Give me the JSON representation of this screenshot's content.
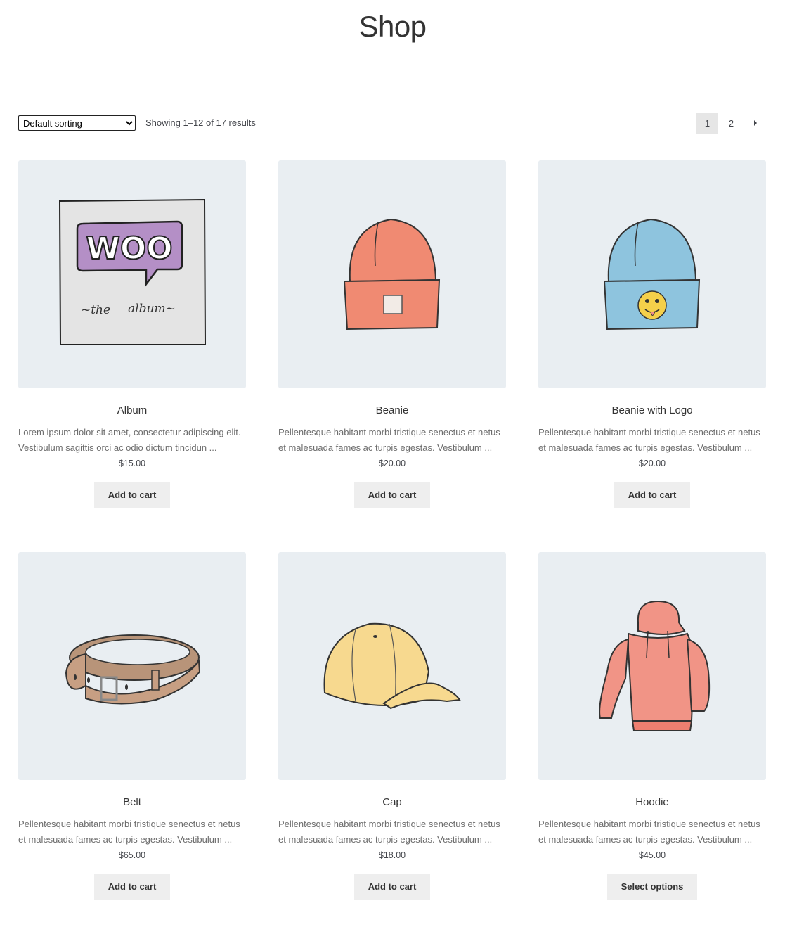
{
  "page": {
    "title": "Shop"
  },
  "toolbar": {
    "sort_selected": "Default sorting",
    "result_count": "Showing 1–12 of 17 results",
    "pagination": [
      "1",
      "2"
    ]
  },
  "products": [
    {
      "name": "Album",
      "excerpt": "Lorem ipsum dolor sit amet, consectetur adipiscing elit. Vestibulum sagittis orci ac odio dictum tincidun ...",
      "price": "$15.00",
      "button": "Add to cart",
      "image_text": [
        "WOO",
        "~the",
        "album~"
      ]
    },
    {
      "name": "Beanie",
      "excerpt": "Pellentesque habitant morbi tristique senectus et netus et malesuada fames ac turpis egestas. Vestibulum ...",
      "price": "$20.00",
      "button": "Add to cart"
    },
    {
      "name": "Beanie with Logo",
      "excerpt": "Pellentesque habitant morbi tristique senectus et netus et malesuada fames ac turpis egestas. Vestibulum ...",
      "price": "$20.00",
      "button": "Add to cart"
    },
    {
      "name": "Belt",
      "excerpt": "Pellentesque habitant morbi tristique senectus et netus et malesuada fames ac turpis egestas. Vestibulum ...",
      "price": "$65.00",
      "button": "Add to cart"
    },
    {
      "name": "Cap",
      "excerpt": "Pellentesque habitant morbi tristique senectus et netus et malesuada fames ac turpis egestas. Vestibulum ...",
      "price": "$18.00",
      "button": "Add to cart"
    },
    {
      "name": "Hoodie",
      "excerpt": "Pellentesque habitant morbi tristique senectus et netus et malesuada fames ac turpis egestas. Vestibulum ...",
      "price": "$45.00",
      "button": "Select options"
    }
  ],
  "colors": {
    "thumb_bg": "#e9eef2",
    "button_bg": "#eeeeee",
    "woo_purple": "#b48fc6",
    "beanie_orange": "#f08a72",
    "beanie_blue": "#8ec4de",
    "belt_brown": "#c79f83",
    "cap_yellow": "#f7d98f",
    "hoodie_pink": "#f19486"
  }
}
